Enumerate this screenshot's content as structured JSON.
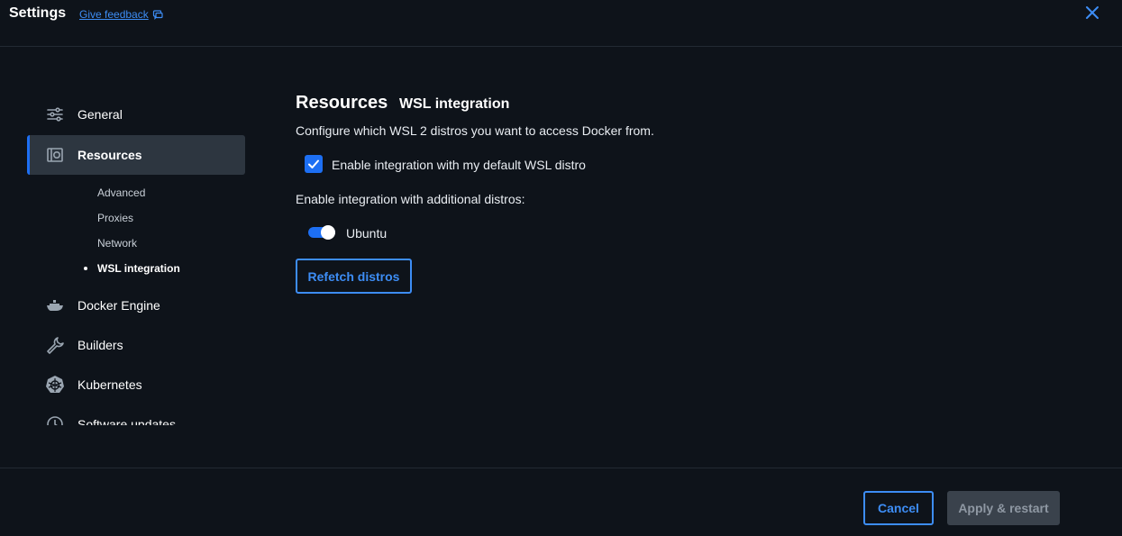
{
  "header": {
    "title": "Settings",
    "feedback_label": "Give feedback"
  },
  "sidebar": {
    "items": [
      {
        "label": "General",
        "icon": "sliders-icon"
      },
      {
        "label": "Resources",
        "icon": "resources-icon",
        "active": true
      },
      {
        "label": "Docker Engine",
        "icon": "whale-icon"
      },
      {
        "label": "Builders",
        "icon": "wrench-icon"
      },
      {
        "label": "Kubernetes",
        "icon": "kubernetes-icon"
      },
      {
        "label": "Software updates",
        "icon": "clock-icon"
      }
    ],
    "sub_items": [
      {
        "label": "Advanced"
      },
      {
        "label": "Proxies"
      },
      {
        "label": "Network"
      },
      {
        "label": "WSL integration",
        "current": true
      }
    ]
  },
  "main": {
    "title": "Resources",
    "subtitle": "WSL integration",
    "description": "Configure which WSL 2 distros you want to access Docker from.",
    "default_distro_label": "Enable integration with my default WSL distro",
    "default_distro_checked": true,
    "additional_label": "Enable integration with additional distros:",
    "distros": [
      {
        "name": "Ubuntu",
        "enabled": true
      }
    ],
    "refetch_label": "Refetch distros"
  },
  "footer": {
    "cancel_label": "Cancel",
    "apply_label": "Apply & restart",
    "apply_disabled": true
  },
  "colors": {
    "accent": "#1d6ff3",
    "link": "#3d8df5",
    "background": "#0e131a",
    "active_bg": "#2d3640"
  }
}
